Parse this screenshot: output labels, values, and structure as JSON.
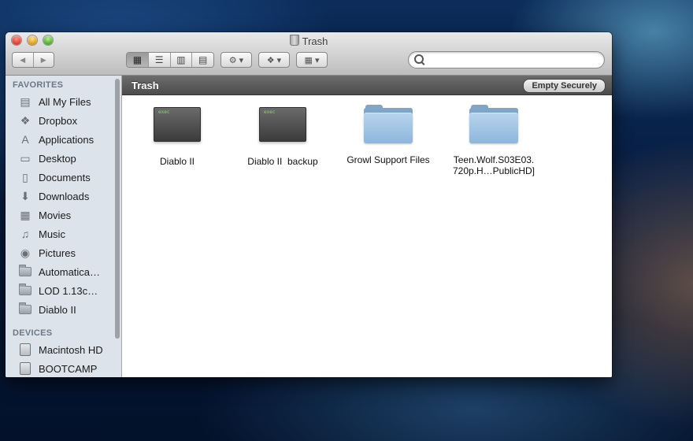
{
  "window": {
    "title": "Trash"
  },
  "toolbar": {
    "back_icon": "◀",
    "forward_icon": "▶",
    "views": [
      {
        "name": "icon-view",
        "glyph": "▦",
        "active": true
      },
      {
        "name": "list-view",
        "glyph": "☰",
        "active": false
      },
      {
        "name": "column-view",
        "glyph": "▥",
        "active": false
      },
      {
        "name": "coverflow-view",
        "glyph": "▤",
        "active": false
      }
    ],
    "action_glyph": "⚙ ▾",
    "dropbox_glyph": "❖ ▾",
    "arrange_glyph": "▦ ▾",
    "search_placeholder": ""
  },
  "sidebar": {
    "favorites_header": "FAVORITES",
    "favorites": [
      {
        "label": "All My Files",
        "icon": "all-files-icon",
        "glyph": "▤"
      },
      {
        "label": "Dropbox",
        "icon": "dropbox-icon",
        "glyph": "❖"
      },
      {
        "label": "Applications",
        "icon": "applications-icon",
        "glyph": "A"
      },
      {
        "label": "Desktop",
        "icon": "desktop-icon",
        "glyph": "▭"
      },
      {
        "label": "Documents",
        "icon": "documents-icon",
        "glyph": "▯"
      },
      {
        "label": "Downloads",
        "icon": "downloads-icon",
        "glyph": "⬇"
      },
      {
        "label": "Movies",
        "icon": "movies-icon",
        "glyph": "▦"
      },
      {
        "label": "Music",
        "icon": "music-icon",
        "glyph": "♫"
      },
      {
        "label": "Pictures",
        "icon": "pictures-icon",
        "glyph": "◉"
      },
      {
        "label": "Automatica…",
        "icon": "folder-icon",
        "glyph": ""
      },
      {
        "label": "LOD 1.13c…",
        "icon": "folder-icon",
        "glyph": ""
      },
      {
        "label": "Diablo II",
        "icon": "folder-icon",
        "glyph": ""
      }
    ],
    "devices_header": "DEVICES",
    "devices": [
      {
        "label": "Macintosh HD",
        "icon": "hard-disk-icon"
      },
      {
        "label": "BOOTCAMP",
        "icon": "hard-disk-icon"
      }
    ]
  },
  "content": {
    "path_title": "Trash",
    "empty_button": "Empty Securely",
    "files": [
      {
        "label": "Diablo II",
        "kind": "exec",
        "tag": "exec"
      },
      {
        "label": "Diablo II  backup",
        "kind": "exec",
        "tag": "exec"
      },
      {
        "label": "Growl Support Files",
        "kind": "folder"
      },
      {
        "label": "Teen.Wolf.S03E03.\n720p.H…PublicHD]",
        "kind": "folder"
      }
    ]
  }
}
